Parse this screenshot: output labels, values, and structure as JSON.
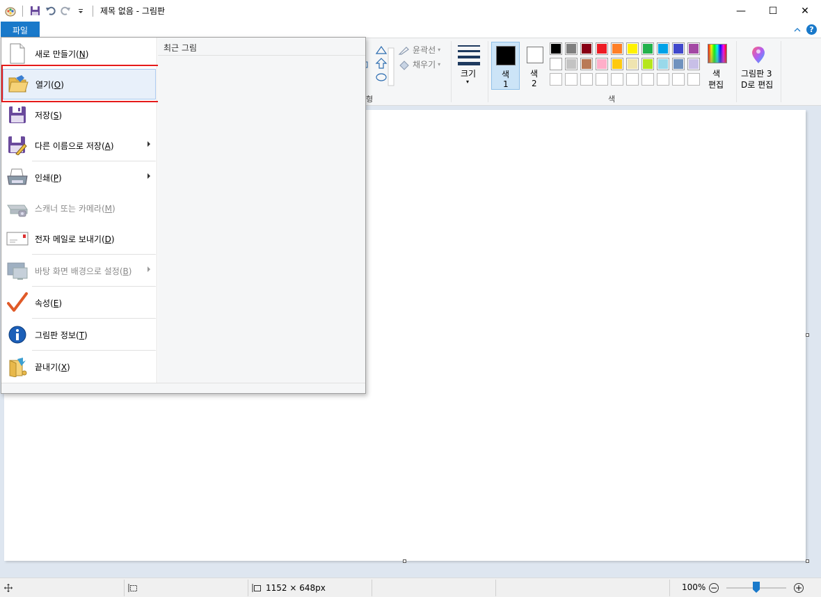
{
  "window": {
    "title": "제목 없음 - 그림판",
    "controls": {
      "minimize": "—",
      "maximize": "☐",
      "close": "✕"
    }
  },
  "ribbon": {
    "file_tab": "파일",
    "outline_label": "윤곽선",
    "fill_label": "채우기",
    "shape_group_fragment": "형",
    "size_label": "크기",
    "color1_label": "색\n1",
    "color1_line1": "색",
    "color1_line2": "1",
    "color2_line1": "색",
    "color2_line2": "2",
    "colors_group_label": "색",
    "edit_colors_line1": "색",
    "edit_colors_line2": "편집",
    "paint3d_line1": "그림판 3",
    "paint3d_line2": "D로 편집",
    "palette_row1": [
      "#000000",
      "#7f7f7f",
      "#880015",
      "#ed1c24",
      "#ff7f27",
      "#fff200",
      "#22b14c",
      "#00a2e8",
      "#3f48cc",
      "#a349a4"
    ],
    "palette_row2": [
      "#ffffff",
      "#c3c3c3",
      "#b97a57",
      "#ffaec9",
      "#ffc90e",
      "#efe4b0",
      "#b5e61d",
      "#99d9ea",
      "#7092be",
      "#c8bfe7"
    ],
    "color1_value": "#000000",
    "color2_value": "#ffffff"
  },
  "file_menu": {
    "items": [
      {
        "label": "새로 만들기",
        "key": "N",
        "icon": "new-file-icon",
        "disabled": false,
        "submenu": false
      },
      {
        "label": "열기",
        "key": "O",
        "icon": "open-folder-icon",
        "disabled": false,
        "submenu": false
      },
      {
        "label": "저장",
        "key": "S",
        "icon": "save-disk-icon",
        "disabled": false,
        "submenu": false
      },
      {
        "label": "다른 이름으로 저장",
        "key": "A",
        "icon": "save-as-icon",
        "disabled": false,
        "submenu": true
      },
      {
        "label": "인쇄",
        "key": "P",
        "icon": "printer-icon",
        "disabled": false,
        "submenu": true
      },
      {
        "label": "스캐너 또는 카메라",
        "key": "M",
        "icon": "scanner-icon",
        "disabled": true,
        "submenu": false
      },
      {
        "label": "전자 메일로 보내기",
        "key": "D",
        "icon": "email-icon",
        "disabled": false,
        "submenu": false
      },
      {
        "label": "바탕 화면 배경으로 설정",
        "key": "B",
        "icon": "desktop-background-icon",
        "disabled": true,
        "submenu": true
      },
      {
        "label": "속성",
        "key": "E",
        "icon": "properties-check-icon",
        "disabled": false,
        "submenu": false
      },
      {
        "label": "그림판 정보",
        "key": "T",
        "icon": "info-icon",
        "disabled": false,
        "submenu": false
      },
      {
        "label": "끝내기",
        "key": "X",
        "icon": "exit-icon",
        "disabled": false,
        "submenu": false
      }
    ],
    "recent_title": "최근 그림"
  },
  "statusbar": {
    "selection_size": "",
    "image_size": "1152 × 648px",
    "zoom": "100%",
    "zoom_level_percent": 100
  }
}
